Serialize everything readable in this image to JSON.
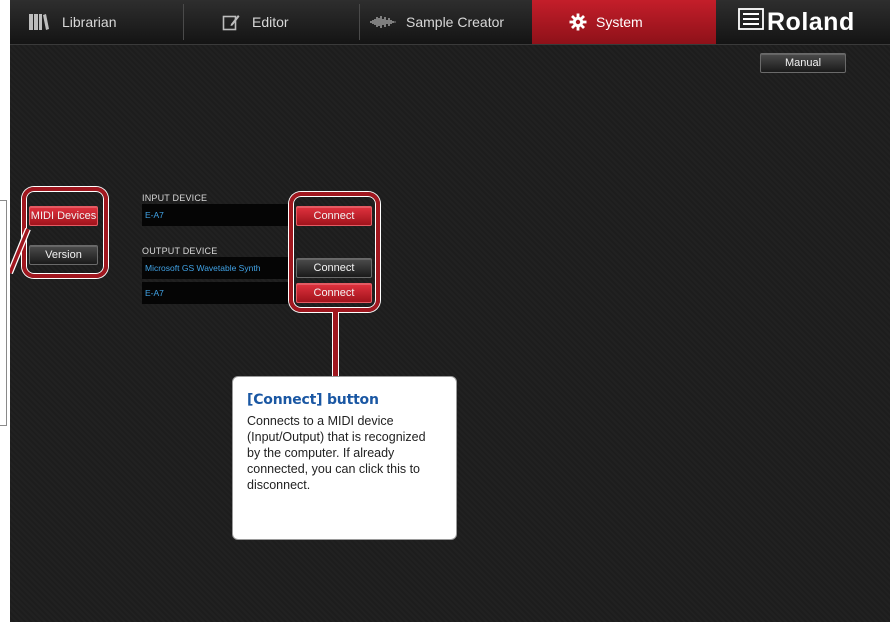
{
  "nav": {
    "tabs": [
      {
        "label": "Librarian",
        "icon": "library-icon"
      },
      {
        "label": "Editor",
        "icon": "edit-icon"
      },
      {
        "label": "Sample Creator",
        "icon": "waveform-icon"
      },
      {
        "label": "System",
        "icon": "gear-icon",
        "active": true
      }
    ],
    "logo": "Roland"
  },
  "toolbar": {
    "manual_label": "Manual"
  },
  "sidebar": {
    "midi_devices_label": "MIDI Devices",
    "version_label": "Version"
  },
  "devices": {
    "input": {
      "label": "INPUT DEVICE",
      "items": [
        {
          "name": "E-A7",
          "button": "Connect",
          "connected": true
        }
      ]
    },
    "output": {
      "label": "OUTPUT DEVICE",
      "items": [
        {
          "name": "Microsoft GS Wavetable Synth",
          "button": "Connect",
          "connected": false
        },
        {
          "name": "E-A7",
          "button": "Connect",
          "connected": true
        }
      ]
    }
  },
  "callout": {
    "title": "[Connect] button",
    "body": "Connects to a MIDI device (Input/Output) that is recognized by the computer. If already connected, you can click this to disconnect."
  },
  "colors": {
    "accent_red": "#c41e2a",
    "device_text": "#41a3e6",
    "callout_title": "#1a57a3"
  }
}
